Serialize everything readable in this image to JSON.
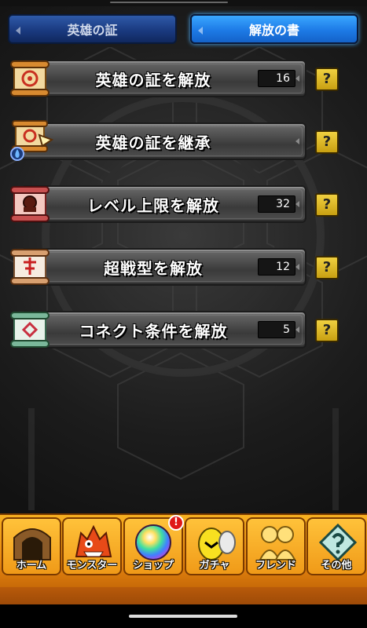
{
  "tabs": [
    {
      "label": "英雄の証",
      "active": false
    },
    {
      "label": "解放の書",
      "active": true
    }
  ],
  "menu": [
    {
      "label": "英雄の証を解放",
      "count": "16",
      "icon": "hero-proof-scroll-icon",
      "help": "?"
    },
    {
      "label": "英雄の証を継承",
      "count": "",
      "icon": "hero-proof-inherit-icon",
      "help": "?"
    },
    {
      "label": "レベル上限を解放",
      "count": "32",
      "icon": "level-cap-scroll-icon",
      "help": "?"
    },
    {
      "label": "超戦型を解放",
      "count": "12",
      "icon": "super-battle-scroll-icon",
      "help": "?"
    },
    {
      "label": "コネクト条件を解放",
      "count": "5",
      "icon": "connect-scroll-icon",
      "help": "?"
    }
  ],
  "nav": [
    {
      "label": "ホーム",
      "icon": "home-gate-icon"
    },
    {
      "label": "モンスター",
      "icon": "monster-icon"
    },
    {
      "label": "ショップ",
      "icon": "orb-icon"
    },
    {
      "label": "ガチャ",
      "icon": "egg-icon"
    },
    {
      "label": "フレンド",
      "icon": "friends-icon"
    },
    {
      "label": "その他",
      "icon": "other-icon"
    }
  ],
  "shop_badge": "!",
  "colors": {
    "tab_active": "#1d7ae6",
    "tab_inactive": "#1a3a80",
    "nav_orange": "#f09a18",
    "help_yellow": "#e0c030",
    "badge_red": "#e01818"
  }
}
